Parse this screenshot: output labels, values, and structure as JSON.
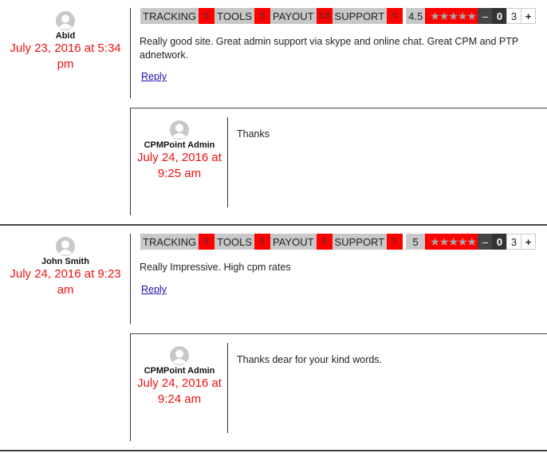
{
  "colors": {
    "accent": "#ff0000",
    "date": "#ee1111",
    "label_bg": "#c8c8c8",
    "link": "#1a0dab"
  },
  "comments": [
    {
      "author": "Abid",
      "date": "July 23, 2016 at 5:34 pm",
      "ratings": [
        {
          "label": "TRACKING",
          "value": "5"
        },
        {
          "label": "TOOLS",
          "value": "5"
        },
        {
          "label": "PAYOUT",
          "value": "3.5"
        },
        {
          "label": "SUPPORT",
          "value": "5"
        }
      ],
      "average": "4.5",
      "stars_glyph": "★★★★★",
      "star_rating": 4.5,
      "vote": {
        "minus": "–",
        "score": "0",
        "count": "3",
        "plus": "+"
      },
      "text": "Really good site. Great admin support via skype and online chat. Great CPM and PTP adnetwork.",
      "reply_label": "Reply",
      "reply": {
        "author": "CPMPoint Admin",
        "date": "July 24, 2016 at 9:25 am",
        "text": "Thanks"
      }
    },
    {
      "author": "John Smith",
      "date": "July 24, 2016 at 9:23 am",
      "ratings": [
        {
          "label": "TRACKING",
          "value": "5"
        },
        {
          "label": "TOOLS",
          "value": "5"
        },
        {
          "label": "PAYOUT",
          "value": "5"
        },
        {
          "label": "SUPPORT",
          "value": "5"
        }
      ],
      "average": "5",
      "stars_glyph": "★★★★★",
      "star_rating": 5,
      "vote": {
        "minus": "–",
        "score": "0",
        "count": "3",
        "plus": "+"
      },
      "text": "Really Impressive. High cpm rates",
      "reply_label": "Reply",
      "reply": {
        "author": "CPMPoint Admin",
        "date": "July 24, 2016 at 9:24 am",
        "text": "Thanks dear for your kind words."
      }
    }
  ]
}
